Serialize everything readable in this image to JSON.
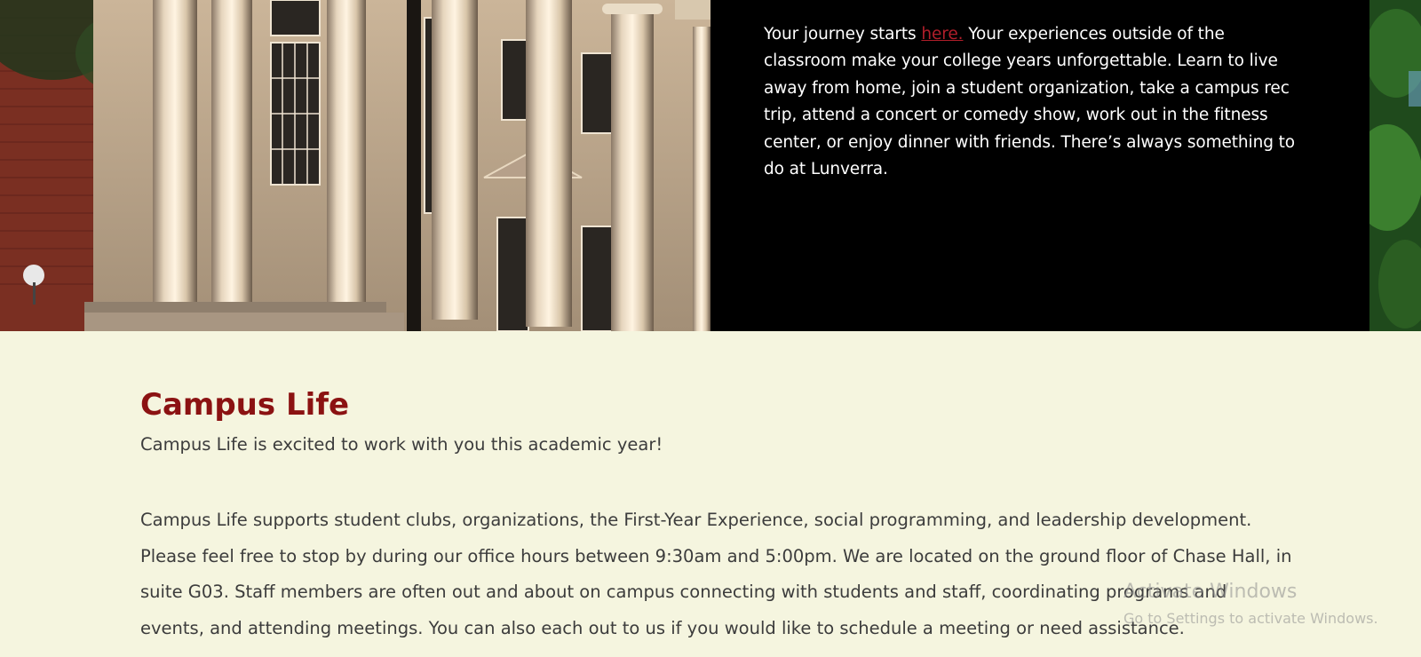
{
  "hero": {
    "text_before_link": "Your journey starts ",
    "link_text": "here.",
    "text_after_link": " Your experiences outside of the classroom make your college years unforgettable. Learn to live away from home, join a student organization, take a campus rec trip, attend a concert or comedy show, work out in the fitness center, or enjoy dinner with friends. There’s always something to do at Lunverra."
  },
  "content": {
    "title": "Campus Life",
    "intro": "Campus Life is excited to work with you this academic year!",
    "body": "Campus Life supports student clubs, organizations, the First-Year Experience, social programming, and leadership development. Please feel free to stop by during our office hours between 9:30am and 5:00pm. We are located on the ground floor of Chase Hall, in suite G03. Staff members are often out and about on campus connecting with students and staff, coordinating programs and events, and attending meetings. You can also each out to us if you would like to schedule a meeting or need assistance."
  },
  "watermark": {
    "title": "Activate Windows",
    "subtitle": "Go to Settings to activate Windows."
  },
  "colors": {
    "page_background": "#f5f5df",
    "title_red": "#8b1212",
    "link_red": "#b01e2a",
    "hero_panel": "#000000"
  }
}
